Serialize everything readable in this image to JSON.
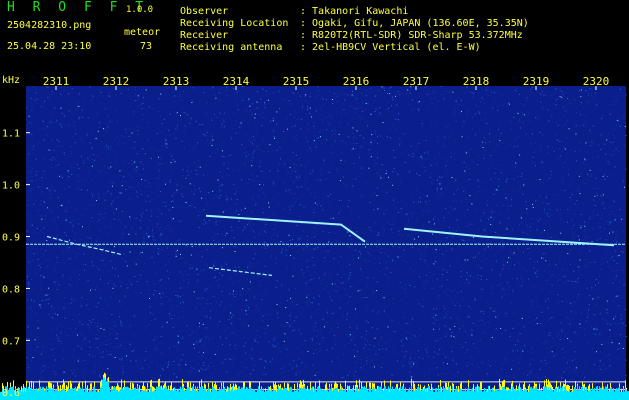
{
  "header": {
    "app_title": "H R O F F T",
    "app_version": "1.0.0",
    "file_name": "2504282310.png",
    "mode_label": "meteor",
    "timestamp": "25.04.28 23:10",
    "count": "73",
    "info": [
      {
        "key": "Observer",
        "value": ": Takanori Kawachi"
      },
      {
        "key": "Receiving Location",
        "value": ": Ogaki, Gifu, JAPAN (136.60E, 35.35N)"
      },
      {
        "key": "Receiver",
        "value": ": R820T2(RTL-SDR) SDR-Sharp 53.372MHz"
      },
      {
        "key": "Receiving antenna",
        "value": ": 2el-HB9CV Vertical (el. E-W)"
      }
    ]
  },
  "colors": {
    "background": "#000000",
    "plot_background": "#0a1f8c",
    "text_yellow": "#ffff44",
    "title_green": "#22dd22",
    "signal": "#9ff3ff",
    "spectrum_fill": "#00e5ff",
    "spectrum_peaks": "#ffff00"
  },
  "chart_data": {
    "type": "heatmap",
    "title": "",
    "ylabel": "kHz",
    "x_ticks": [
      "2311",
      "2312",
      "2313",
      "2314",
      "2315",
      "2316",
      "2317",
      "2318",
      "2319",
      "2320"
    ],
    "y_ticks": [
      "1.1",
      "1.0",
      "0.9",
      "0.8",
      "0.7",
      "0.6"
    ],
    "y_tick_values": [
      1.1,
      1.0,
      0.9,
      0.8,
      0.7,
      0.6
    ],
    "ylim": [
      0.585,
      1.19
    ],
    "xlim": [
      2310.5,
      2320.5
    ],
    "carrier_khz": 0.885,
    "traces": [
      {
        "points": [
          [
            2313.5,
            0.94
          ],
          [
            2315.75,
            0.923
          ],
          [
            2316.15,
            0.89
          ]
        ]
      },
      {
        "points": [
          [
            2316.8,
            0.915
          ],
          [
            2318.1,
            0.9
          ],
          [
            2320.3,
            0.883
          ]
        ]
      },
      {
        "points": [
          [
            2310.85,
            0.9
          ],
          [
            2311.35,
            0.885
          ],
          [
            2311.75,
            0.875
          ],
          [
            2312.1,
            0.865
          ]
        ]
      },
      {
        "points": [
          [
            2313.55,
            0.84
          ],
          [
            2314.6,
            0.825
          ]
        ]
      }
    ],
    "ref_lines_khz": [
      0.62,
      0.605
    ]
  }
}
